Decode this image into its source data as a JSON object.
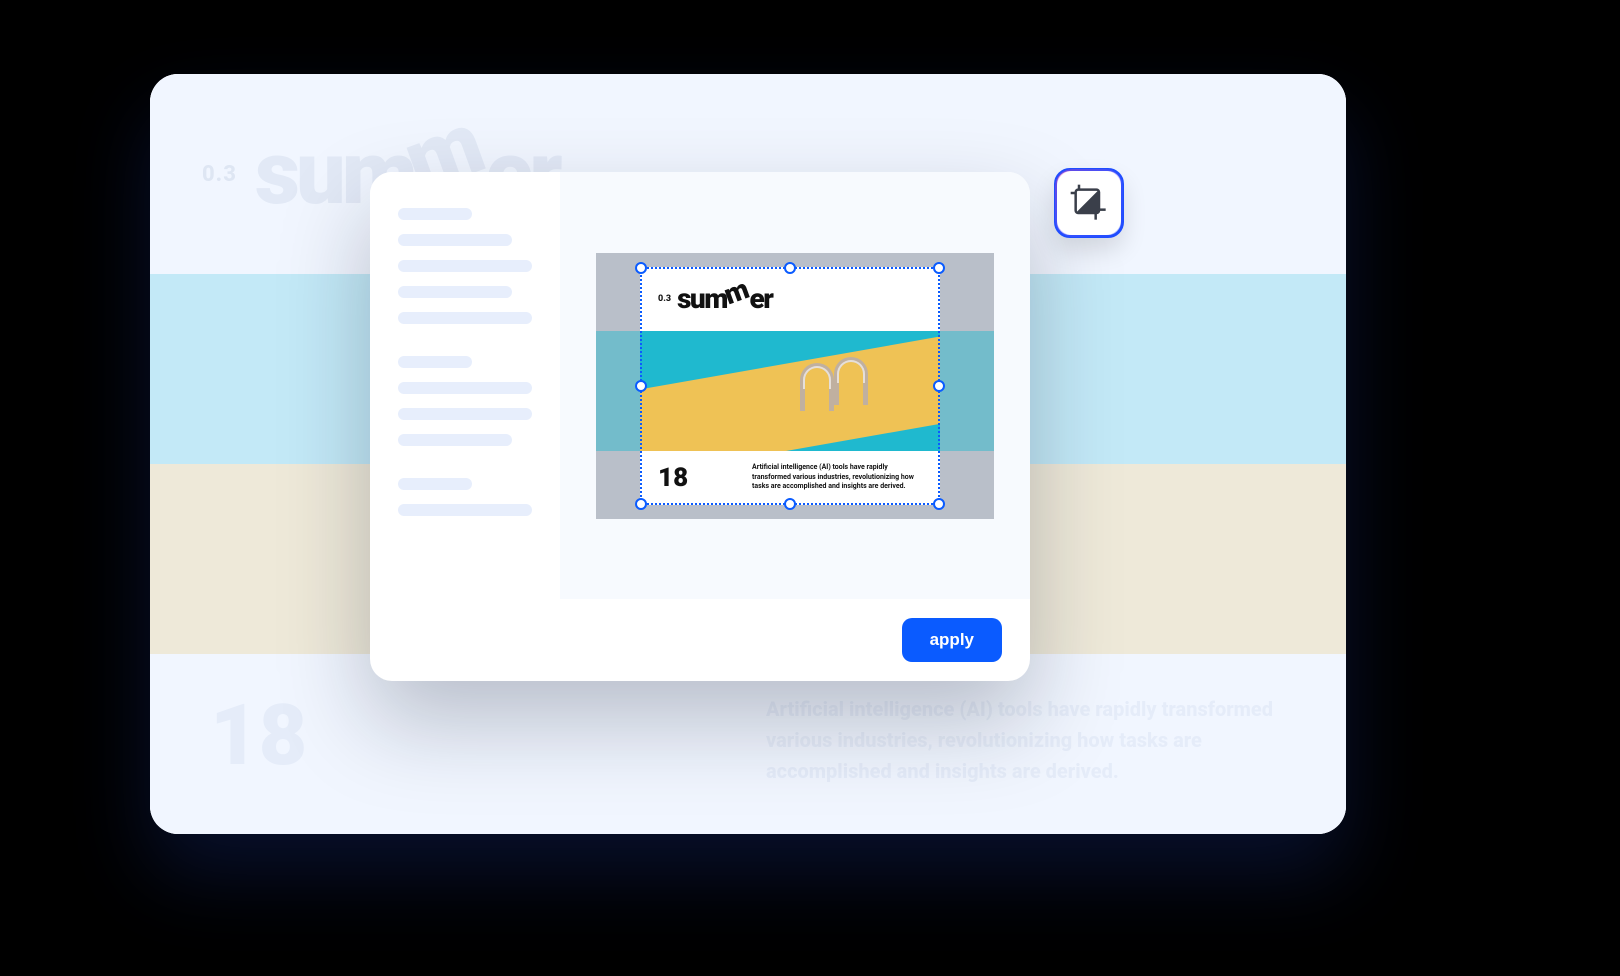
{
  "background": {
    "version": "0.3",
    "logo_pre": "sum",
    "logo_m": "m",
    "logo_post": "er",
    "page_number": "18",
    "paragraph": "Artificial intelligence (AI) tools have rapidly transformed various industries, revolutionizing how tasks are accomplished and insights are derived."
  },
  "modal": {
    "slide": {
      "version": "0.3",
      "logo_pre": "sum",
      "logo_m": "m",
      "logo_post": "er",
      "page_number": "18",
      "paragraph": "Artificial intelligence (AI) tools have rapidly transformed various industries, revolutionizing how tasks are accomplished and insights are derived."
    },
    "apply_label": "apply"
  },
  "tool": {
    "name": "crop"
  }
}
